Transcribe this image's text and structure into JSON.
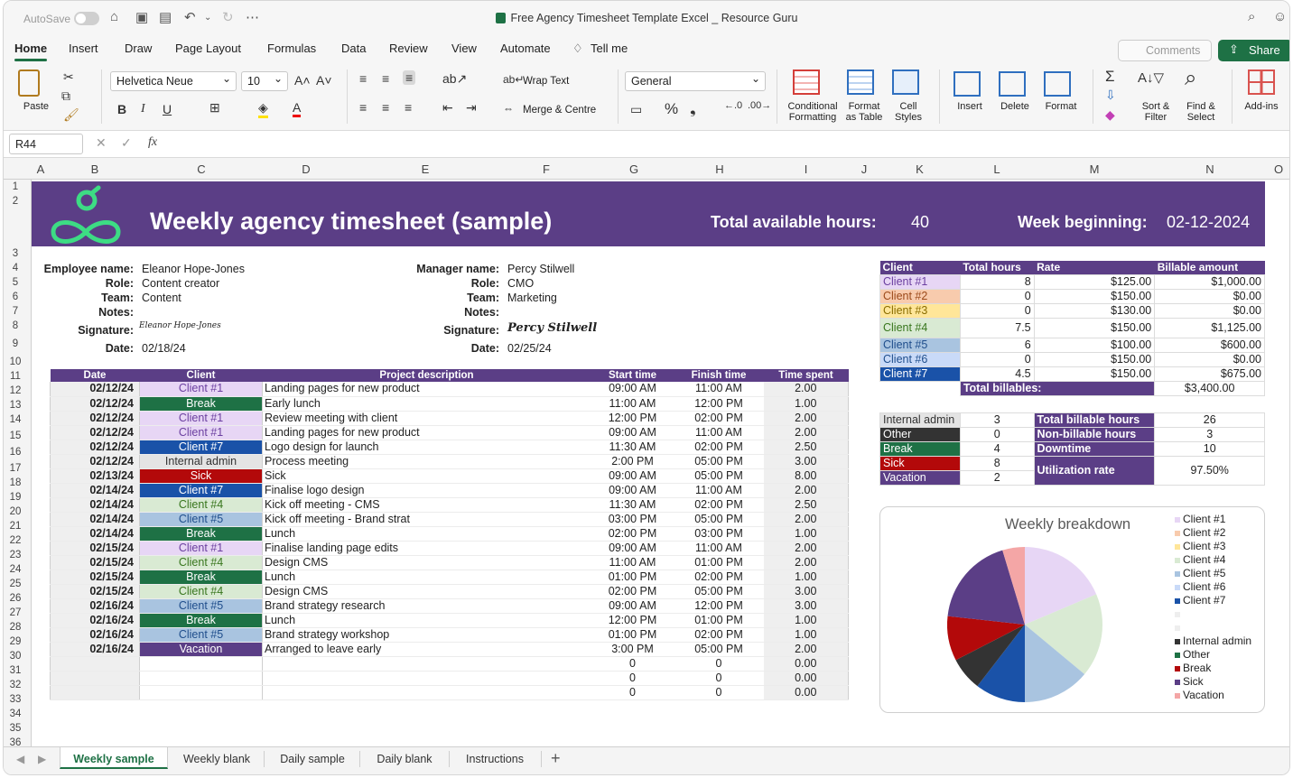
{
  "titlebar": {
    "autosave": "AutoSave",
    "doc_title": "Free Agency Timesheet Template Excel _ Resource Guru"
  },
  "ribbon_tabs": [
    "Home",
    "Insert",
    "Draw",
    "Page Layout",
    "Formulas",
    "Data",
    "Review",
    "View",
    "Automate",
    "Tell me"
  ],
  "ribbon_actions": {
    "comments": "Comments",
    "share": "Share"
  },
  "toolbar": {
    "paste": "Paste",
    "font_name": "Helvetica Neue",
    "font_size": "10",
    "wrap_text": "Wrap Text",
    "merge_centre": "Merge & Centre",
    "number_format": "General",
    "conditional_formatting": "Conditional Formatting",
    "format_as_table": "Format as Table",
    "cell_styles": "Cell Styles",
    "insert": "Insert",
    "delete": "Delete",
    "format": "Format",
    "sort_filter": "Sort & Filter",
    "find_select": "Find & Select",
    "add_ins": "Add-ins",
    "bold": "B",
    "italic": "I",
    "underline": "U"
  },
  "formula_bar": {
    "name_box": "R44",
    "fx": "fx"
  },
  "columns": [
    "A",
    "B",
    "C",
    "D",
    "E",
    "F",
    "G",
    "H",
    "I",
    "J",
    "K",
    "L",
    "M",
    "N",
    "O"
  ],
  "rows": [
    "1",
    "2",
    "3",
    "4",
    "5",
    "6",
    "7",
    "8",
    "9",
    "10",
    "11",
    "12",
    "13",
    "14",
    "15",
    "16",
    "17",
    "18",
    "19",
    "20",
    "21",
    "22",
    "23",
    "24",
    "25",
    "26",
    "27",
    "28",
    "29",
    "30",
    "31",
    "32",
    "33",
    "34",
    "35",
    "36"
  ],
  "banner": {
    "title": "Weekly agency timesheet (sample)",
    "total_label": "Total available hours:",
    "total_value": "40",
    "week_label": "Week beginning:",
    "week_value": "02-12-2024"
  },
  "employee": {
    "name_label": "Employee name:",
    "name": "Eleanor Hope-Jones",
    "role_label": "Role:",
    "role": "Content creator",
    "team_label": "Team:",
    "team": "Content",
    "notes_label": "Notes:",
    "signature_label": "Signature:",
    "signature": "Eleanor Hope-Jones",
    "date_label": "Date:",
    "date": "02/18/24"
  },
  "manager": {
    "name_label": "Manager name:",
    "name": "Percy Stilwell",
    "role_label": "Role:",
    "role": "CMO",
    "team_label": "Team:",
    "team": "Marketing",
    "notes_label": "Notes:",
    "signature_label": "Signature:",
    "signature": "Percy Stilwell",
    "date_label": "Date:",
    "date": "02/25/24"
  },
  "timesheet": {
    "headers": [
      "Date",
      "Client",
      "Project description",
      "Start time",
      "Finish time",
      "Time spent"
    ],
    "rows": [
      {
        "date": "02/12/24",
        "client": "Client #1",
        "desc": "Landing pages for new product",
        "start": "09:00 AM",
        "finish": "11:00 AM",
        "spent": "2.00",
        "bg": "#e7d6f5",
        "fg": "#6b3fa0",
        "daybreak": false
      },
      {
        "date": "02/12/24",
        "client": "Break",
        "desc": "Early lunch",
        "start": "11:00 AM",
        "finish": "12:00 PM",
        "spent": "1.00",
        "bg": "#1e7145",
        "fg": "#ffffff",
        "daybreak": false
      },
      {
        "date": "02/12/24",
        "client": "Client #1",
        "desc": "Review meeting with client",
        "start": "12:00 PM",
        "finish": "02:00 PM",
        "spent": "2.00",
        "bg": "#e7d6f5",
        "fg": "#6b3fa0",
        "daybreak": false
      },
      {
        "date": "02/12/24",
        "client": "Client #1",
        "desc": "Landing pages for new product",
        "start": "09:00 AM",
        "finish": "11:00 AM",
        "spent": "2.00",
        "bg": "#e7d6f5",
        "fg": "#6b3fa0",
        "daybreak": false
      },
      {
        "date": "02/12/24",
        "client": "Client #7",
        "desc": "Logo design for launch",
        "start": "11:30 AM",
        "finish": "02:00 PM",
        "spent": "2.50",
        "bg": "#1a52a8",
        "fg": "#ffffff",
        "daybreak": false
      },
      {
        "date": "02/12/24",
        "client": "Internal admin",
        "desc": "Process meeting",
        "start": "2:00 PM",
        "finish": "05:00 PM",
        "spent": "3.00",
        "bg": "#e4e4e4",
        "fg": "#333333",
        "daybreak": false
      },
      {
        "date": "02/13/24",
        "client": "Sick",
        "desc": "Sick",
        "start": "09:00 AM",
        "finish": "05:00 PM",
        "spent": "8.00",
        "bg": "#b3090a",
        "fg": "#ffffff",
        "daybreak": true
      },
      {
        "date": "02/14/24",
        "client": "Client #7",
        "desc": "Finalise logo design",
        "start": "09:00 AM",
        "finish": "11:00 AM",
        "spent": "2.00",
        "bg": "#1a52a8",
        "fg": "#ffffff",
        "daybreak": true
      },
      {
        "date": "02/14/24",
        "client": "Client #4",
        "desc": "Kick off meeting - CMS",
        "start": "11:30 AM",
        "finish": "02:00 PM",
        "spent": "2.50",
        "bg": "#d9ead3",
        "fg": "#38761d",
        "daybreak": false
      },
      {
        "date": "02/14/24",
        "client": "Client #5",
        "desc": "Kick off meeting - Brand strat",
        "start": "03:00 PM",
        "finish": "05:00 PM",
        "spent": "2.00",
        "bg": "#a9c4e0",
        "fg": "#1f4e8c",
        "daybreak": false
      },
      {
        "date": "02/14/24",
        "client": "Break",
        "desc": "Lunch",
        "start": "02:00 PM",
        "finish": "03:00 PM",
        "spent": "1.00",
        "bg": "#1e7145",
        "fg": "#ffffff",
        "daybreak": false
      },
      {
        "date": "02/15/24",
        "client": "Client #1",
        "desc": "Finalise landing page edits",
        "start": "09:00 AM",
        "finish": "11:00 AM",
        "spent": "2.00",
        "bg": "#e7d6f5",
        "fg": "#6b3fa0",
        "daybreak": true
      },
      {
        "date": "02/15/24",
        "client": "Client #4",
        "desc": "Design CMS",
        "start": "11:00 AM",
        "finish": "01:00 PM",
        "spent": "2.00",
        "bg": "#d9ead3",
        "fg": "#38761d",
        "daybreak": false
      },
      {
        "date": "02/15/24",
        "client": "Break",
        "desc": "Lunch",
        "start": "01:00 PM",
        "finish": "02:00 PM",
        "spent": "1.00",
        "bg": "#1e7145",
        "fg": "#ffffff",
        "daybreak": false
      },
      {
        "date": "02/15/24",
        "client": "Client #4",
        "desc": "Design CMS",
        "start": "02:00 PM",
        "finish": "05:00 PM",
        "spent": "3.00",
        "bg": "#d9ead3",
        "fg": "#38761d",
        "daybreak": false
      },
      {
        "date": "02/16/24",
        "client": "Client #5",
        "desc": "Brand strategy research",
        "start": "09:00 AM",
        "finish": "12:00 PM",
        "spent": "3.00",
        "bg": "#a9c4e0",
        "fg": "#1f4e8c",
        "daybreak": true
      },
      {
        "date": "02/16/24",
        "client": "Break",
        "desc": "Lunch",
        "start": "12:00 PM",
        "finish": "01:00 PM",
        "spent": "1.00",
        "bg": "#1e7145",
        "fg": "#ffffff",
        "daybreak": false
      },
      {
        "date": "02/16/24",
        "client": "Client #5",
        "desc": "Brand strategy workshop",
        "start": "01:00 PM",
        "finish": "02:00 PM",
        "spent": "1.00",
        "bg": "#a9c4e0",
        "fg": "#1f4e8c",
        "daybreak": false
      },
      {
        "date": "02/16/24",
        "client": "Vacation",
        "desc": "Arranged to leave early",
        "start": "3:00 PM",
        "finish": "05:00 PM",
        "spent": "2.00",
        "bg": "#5b3e86",
        "fg": "#ffffff",
        "daybreak": false
      },
      {
        "date": "",
        "client": "",
        "desc": "",
        "start": "0",
        "finish": "0",
        "spent": "0.00",
        "bg": "#ffffff",
        "fg": "#333333",
        "daybreak": false
      },
      {
        "date": "",
        "client": "",
        "desc": "",
        "start": "0",
        "finish": "0",
        "spent": "0.00",
        "bg": "#ffffff",
        "fg": "#333333",
        "daybreak": false
      },
      {
        "date": "",
        "client": "",
        "desc": "",
        "start": "0",
        "finish": "0",
        "spent": "0.00",
        "bg": "#ffffff",
        "fg": "#333333",
        "daybreak": false
      }
    ]
  },
  "client_summary": {
    "headers": [
      "Client",
      "Total hours",
      "Rate",
      "Billable amount"
    ],
    "rows": [
      {
        "client": "Client #1",
        "hours": "8",
        "rate": "$125.00",
        "amount": "$1,000.00",
        "bg": "#e7d6f5",
        "fg": "#6b3fa0"
      },
      {
        "client": "Client #2",
        "hours": "0",
        "rate": "$150.00",
        "amount": "$0.00",
        "bg": "#f8cbad",
        "fg": "#9c4a1a"
      },
      {
        "client": "Client #3",
        "hours": "0",
        "rate": "$130.00",
        "amount": "$0.00",
        "bg": "#ffe699",
        "fg": "#8a6d00"
      },
      {
        "client": "Client #4",
        "hours": "7.5",
        "rate": "$150.00",
        "amount": "$1,125.00",
        "bg": "#d9ead3",
        "fg": "#38761d"
      },
      {
        "client": "Client #5",
        "hours": "6",
        "rate": "$100.00",
        "amount": "$600.00",
        "bg": "#a9c4e0",
        "fg": "#1f4e8c"
      },
      {
        "client": "Client #6",
        "hours": "0",
        "rate": "$150.00",
        "amount": "$0.00",
        "bg": "#c9daf8",
        "fg": "#1f4e8c"
      },
      {
        "client": "Client #7",
        "hours": "4.5",
        "rate": "$150.00",
        "amount": "$675.00",
        "bg": "#1a52a8",
        "fg": "#ffffff"
      }
    ],
    "total_label": "Total billables:",
    "total_value": "$3,400.00"
  },
  "other_summary": {
    "rows": [
      {
        "label": "Internal admin",
        "value": "3",
        "bg": "#e4e4e4",
        "fg": "#333333"
      },
      {
        "label": "Other",
        "value": "0",
        "bg": "#333333",
        "fg": "#ffffff"
      },
      {
        "label": "Break",
        "value": "4",
        "bg": "#1e7145",
        "fg": "#ffffff"
      },
      {
        "label": "Sick",
        "value": "8",
        "bg": "#b3090a",
        "fg": "#ffffff"
      },
      {
        "label": "Vacation",
        "value": "2",
        "bg": "#5b3e86",
        "fg": "#ffffff"
      }
    ],
    "stats": [
      {
        "label": "Total billable hours",
        "value": "26"
      },
      {
        "label": "Non-billable hours",
        "value": "3"
      },
      {
        "label": "Downtime",
        "value": "10"
      },
      {
        "label": "Utilization rate",
        "value": "97.50%"
      }
    ]
  },
  "chart_data": {
    "type": "pie",
    "title": "Weekly breakdown",
    "legend_position": "right",
    "slices": [
      {
        "name": "Client #1",
        "value": 8,
        "color": "#e7d6f5"
      },
      {
        "name": "Client #2",
        "value": 0,
        "color": "#f8cbad"
      },
      {
        "name": "Client #3",
        "value": 0,
        "color": "#ffe699"
      },
      {
        "name": "Client #4",
        "value": 7.5,
        "color": "#d9ead3"
      },
      {
        "name": "Client #5",
        "value": 6,
        "color": "#a9c4e0"
      },
      {
        "name": "Client #6",
        "value": 0,
        "color": "#c9daf8"
      },
      {
        "name": "Client #7",
        "value": 4.5,
        "color": "#1a52a8"
      },
      {
        "name": "",
        "value": 0,
        "color": "#eeeeee"
      },
      {
        "name": "",
        "value": 0,
        "color": "#eeeeee"
      },
      {
        "name": "Internal admin",
        "value": 3,
        "color": "#333333"
      },
      {
        "name": "Other",
        "value": 0,
        "color": "#1e7145"
      },
      {
        "name": "Break",
        "value": 4,
        "color": "#b3090a"
      },
      {
        "name": "Sick",
        "value": 8,
        "color": "#5b3e86"
      },
      {
        "name": "Vacation",
        "value": 2,
        "color": "#f4a6a6"
      }
    ]
  },
  "sheet_tabs": [
    "Weekly sample",
    "Weekly blank",
    "Daily sample",
    "Daily blank",
    "Instructions"
  ],
  "colors": {
    "accent": "#1e7145",
    "banner": "#5b3e86"
  }
}
